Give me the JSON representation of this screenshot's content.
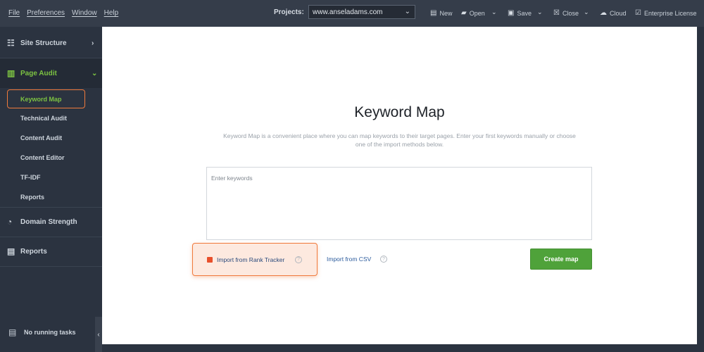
{
  "menu": [
    "File",
    "Preferences",
    "Window",
    "Help"
  ],
  "toolbar": {
    "projects_label": "Projects:",
    "project_value": "www.anseladams.com",
    "new": "New",
    "open": "Open",
    "save": "Save",
    "close": "Close",
    "cloud": "Cloud",
    "license": "Enterprise License"
  },
  "sidebar": {
    "site_structure": "Site Structure",
    "page_audit": "Page Audit",
    "sub_items": [
      "Keyword Map",
      "Technical Audit",
      "Content Audit",
      "Content Editor",
      "TF-IDF",
      "Reports"
    ],
    "domain_strength": "Domain Strength",
    "reports": "Reports",
    "status": "No running tasks"
  },
  "main": {
    "title": "Keyword Map",
    "description": "Keyword Map is a convenient place where you can map keywords to their target pages. Enter your first keywords manually or choose one of the import methods below.",
    "input_placeholder": "Enter keywords",
    "import_rank_tracker": "Import from Rank Tracker",
    "import_csv": "Import from CSV",
    "create_button": "Create map",
    "help_glyph": "?"
  },
  "colors": {
    "accent_green": "#7cc242",
    "button_green": "#4fa23a",
    "highlight_orange": "#f07a3c",
    "sidebar_bg": "#2b3340"
  }
}
